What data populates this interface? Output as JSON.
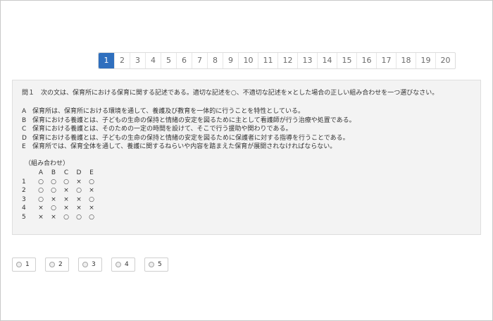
{
  "pagination": {
    "pages": [
      "1",
      "2",
      "3",
      "4",
      "5",
      "6",
      "7",
      "8",
      "9",
      "10",
      "11",
      "12",
      "13",
      "14",
      "15",
      "16",
      "17",
      "18",
      "19",
      "20"
    ],
    "active_index": 0
  },
  "question": {
    "title": "問１　次の文は、保育所における保育に関する記述である。適切な記述を○、不適切な記述を×とした場合の正しい組み合わせを一つ選びなさい。",
    "statements": [
      {
        "letter": "A",
        "text": "保育所は、保育所における環境を通して、養護及び教育を一体的に行うことを特性としている。"
      },
      {
        "letter": "B",
        "text": "保育における養護とは、子どもの生命の保持と情緒の安定を図るために主として看護師が行う治療や処置である。"
      },
      {
        "letter": "C",
        "text": "保育における養護とは、そのための一定の時間を設けて、そこで行う援助や関わりである。"
      },
      {
        "letter": "D",
        "text": "保育における養護とは、子どもの生命の保持と情緒の安定を図るために保護者に対する指導を行うことである。"
      },
      {
        "letter": "E",
        "text": "保育所では、保育全体を通して、養護に関するねらいや内容を踏まえた保育が展開されなければならない。"
      }
    ],
    "combo_heading": "（組み合わせ）",
    "combo_columns": [
      "A",
      "B",
      "C",
      "D",
      "E"
    ],
    "combo_rows": [
      {
        "num": "1",
        "marks": [
          "○",
          "○",
          "○",
          "×",
          "○"
        ]
      },
      {
        "num": "2",
        "marks": [
          "○",
          "○",
          "×",
          "○",
          "×"
        ]
      },
      {
        "num": "3",
        "marks": [
          "○",
          "×",
          "×",
          "×",
          "○"
        ]
      },
      {
        "num": "4",
        "marks": [
          "×",
          "○",
          "×",
          "×",
          "×"
        ]
      },
      {
        "num": "5",
        "marks": [
          "×",
          "×",
          "○",
          "○",
          "○"
        ]
      }
    ]
  },
  "answers": [
    "1",
    "2",
    "3",
    "4",
    "5"
  ]
}
